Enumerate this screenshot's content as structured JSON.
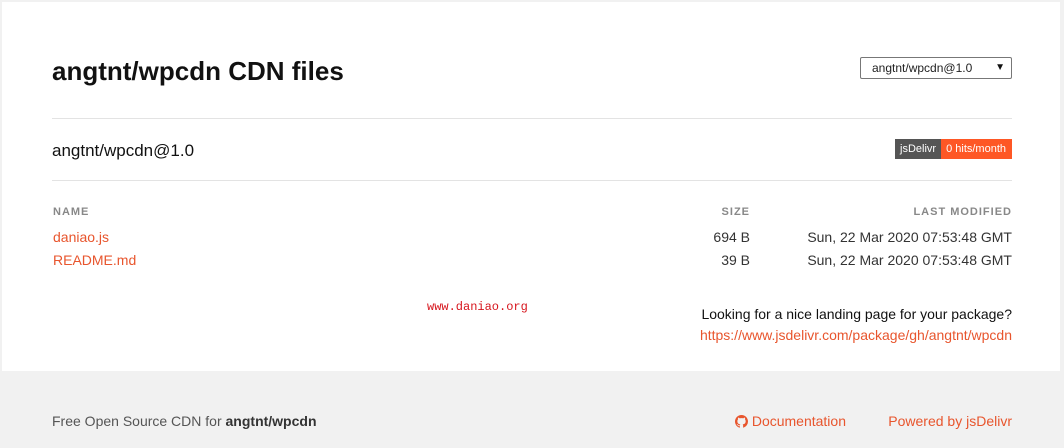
{
  "header": {
    "title": "angtnt/wpcdn CDN files",
    "version_select": {
      "selected": "angtnt/wpcdn@1.0",
      "arrow": "▼"
    }
  },
  "package": {
    "name": "angtnt/wpcdn@1.0",
    "badge": {
      "label": "jsDelivr",
      "value": "0 hits/month"
    }
  },
  "table": {
    "columns": {
      "name": "NAME",
      "size": "SIZE",
      "modified": "LAST MODIFIED"
    },
    "rows": [
      {
        "name": "daniao.js",
        "size": "694 B",
        "modified": "Sun, 22 Mar 2020 07:53:48 GMT"
      },
      {
        "name": "README.md",
        "size": "39 B",
        "modified": "Sun, 22 Mar 2020 07:53:48 GMT"
      }
    ]
  },
  "watermark": "www.daniao.org",
  "landing": {
    "question": "Looking for a nice landing page for your package?",
    "link": "https://www.jsdelivr.com/package/gh/angtnt/wpcdn"
  },
  "footer": {
    "left_prefix": "Free Open Source CDN for ",
    "left_package": "angtnt/wpcdn",
    "documentation": "Documentation",
    "documentation_icon": "github-icon",
    "powered": "Powered by jsDelivr"
  },
  "colors": {
    "accent": "#e8552d",
    "badge_left": "#555555",
    "badge_right": "#fe5725",
    "watermark": "#d6141c"
  }
}
